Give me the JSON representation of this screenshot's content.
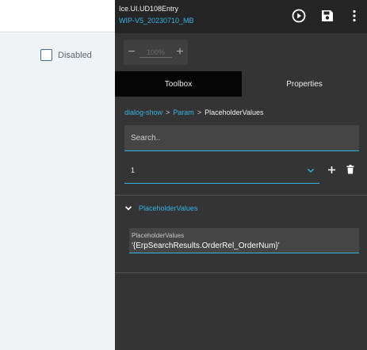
{
  "app": {
    "title": "Ice.UI.UD108Entry",
    "subtitle": "WIP-V5_20230710_MB"
  },
  "canvas": {
    "checkbox_label": "Disabled",
    "checkbox_checked": false
  },
  "header_icons": [
    "play-circle-icon",
    "save-icon",
    "more-vertical-icon"
  ],
  "zoom": {
    "value": "100%",
    "minus": "−",
    "plus": "+"
  },
  "tabs": [
    {
      "label": "Toolbox",
      "active": true
    },
    {
      "label": "Properties",
      "active": false
    }
  ],
  "breadcrumb": {
    "items": [
      "dialog-show",
      "Param"
    ],
    "current": "PlaceholderValues",
    "separator": ">"
  },
  "search": {
    "placeholder": "Search.."
  },
  "selector": {
    "value": "1",
    "add_icon": "plus-icon",
    "delete_icon": "trash-icon"
  },
  "section": {
    "title": "PlaceholderValues",
    "expanded": true
  },
  "field": {
    "label": "PlaceholderValues",
    "value": "'{ErpSearchResults.OrderRel_OrderNum}'"
  },
  "colors": {
    "accent": "#36b3e6",
    "panel_bg": "#343434",
    "header_bg": "#252525",
    "active_tab_bg": "#050505",
    "canvas_bg": "#f0f3f6"
  }
}
